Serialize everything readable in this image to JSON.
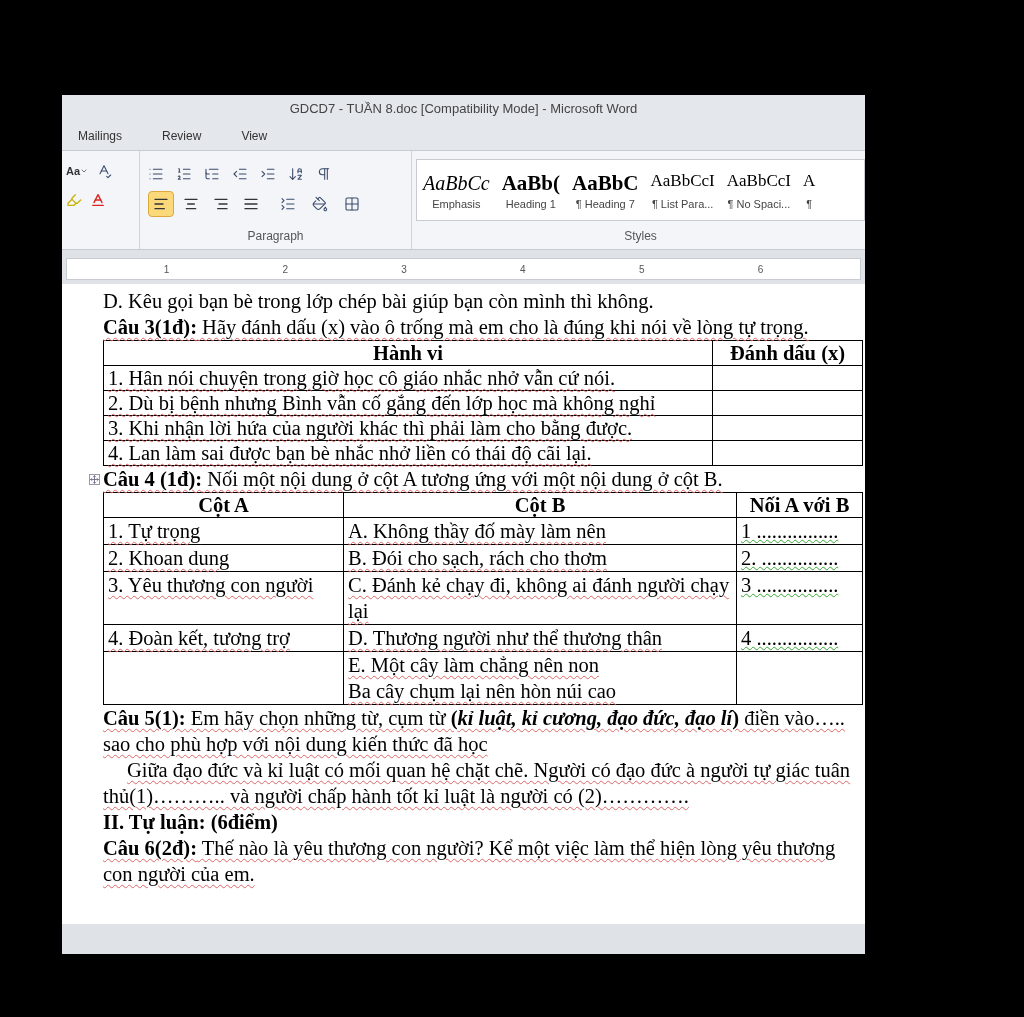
{
  "window": {
    "title": "GDCD7 - TUẦN 8.doc [Compatibility Mode]  -  Microsoft Word"
  },
  "tabs": [
    {
      "label": "Mailings",
      "selected": false
    },
    {
      "label": "Review",
      "selected": false
    },
    {
      "label": "View",
      "selected": false
    }
  ],
  "ribbon": {
    "font_group": {
      "change_case": "Aa"
    },
    "paragraph_group": {
      "label": "Paragraph",
      "alignment": [
        {
          "kind": "left",
          "selected": true
        },
        {
          "kind": "center",
          "selected": false
        },
        {
          "kind": "right",
          "selected": false
        },
        {
          "kind": "justify",
          "selected": false
        }
      ]
    },
    "styles_group": {
      "label": "Styles",
      "styles": [
        {
          "preview": "AaBbCc",
          "name": "Emphasis",
          "kind": "emphasis"
        },
        {
          "preview": "AaBb(",
          "name": "Heading 1",
          "kind": "heading"
        },
        {
          "preview": "AaBbC",
          "name": "¶ Heading 7",
          "kind": "heading"
        },
        {
          "preview": "AaBbCcI",
          "name": "¶ List Para...",
          "kind": "normal"
        },
        {
          "preview": "AaBbCcI",
          "name": "¶ No Spaci...",
          "kind": "normal"
        },
        {
          "preview": "A",
          "name": "¶",
          "kind": "normal"
        }
      ]
    }
  },
  "ruler": {
    "marks": [
      "1",
      "2",
      "3",
      "4",
      "5",
      "6"
    ]
  },
  "document": {
    "p1": "D. Kêu gọi bạn bè trong lớp chép bài giúp bạn còn mình thì không.",
    "q3": "**Câu 3(1đ):** Hãy đánh dấu (x) vào ô trống mà em cho là đúng khi nói về lòng tự trọng.",
    "table1": {
      "columns": [
        "Hành vi",
        "Đánh dấu (x)"
      ],
      "rows": [
        "1. Hân nói chuyện trong giờ học cô giáo nhắc nhở vẫn cứ nói.",
        "2. Dù bị bệnh nhưng Bình vẫn cố gắng đến lớp học mà không nghỉ",
        "3. Khi nhận lời hứa của người khác thì phải làm cho bằng được.",
        "4. Lan làm sai được bạn bè nhắc nhở liền có thái độ cãi lại."
      ]
    },
    "q4": "**Câu 4 (1đ):** Nối một nội dung ở cột A tương ứng với một nội dung ở cột B.",
    "table2": {
      "columns": [
        "Cột A",
        "Cột B",
        "Nối A với B"
      ],
      "rows": [
        {
          "col_a": "1. Tự trọng",
          "col_b": [
            "A. Không thầy đố mày làm nên"
          ],
          "match": "1 ................"
        },
        {
          "col_a": "2. Khoan dung",
          "col_b": [
            "B. Đói cho sạch, rách cho thơm"
          ],
          "match": "2. ..............."
        },
        {
          "col_a": "3. Yêu thương con người",
          "col_b": [
            "C. Đánh kẻ chạy đi, không ai đánh người chạy lại"
          ],
          "match": "3 ................"
        },
        {
          "col_a": "4. Đoàn kết, tương trợ",
          "col_b": [
            "D. Thương người như thể thương thân"
          ],
          "match": "4 ................"
        },
        {
          "col_b": [
            "E. Một cây làm chẳng nên non",
            "Ba cây chụm lại nên hòn núi cao"
          ]
        }
      ]
    },
    "q5": "**Câu 5(1):** Em hãy chọn những từ, cụm từ **(*kỉ luật, kỉ cương, đạo đức, đạo lí*)** điền vào….. sao cho phù hợp với nội dung kiến thức đã học",
    "p2": "Giữa đạo đức và kỉ luật có mối quan hệ chặt chẽ. Người có đạo đức à người tự giác tuân thủ(1)……….. và người chấp hành tốt kỉ luật là người có (2)………….",
    "section": "II. Tự luận: (6điểm)",
    "q6": "**Câu 6(2đ):** Thế nào là yêu thương con người? Kể một việc làm thể hiện lòng yêu thương con người của em."
  }
}
